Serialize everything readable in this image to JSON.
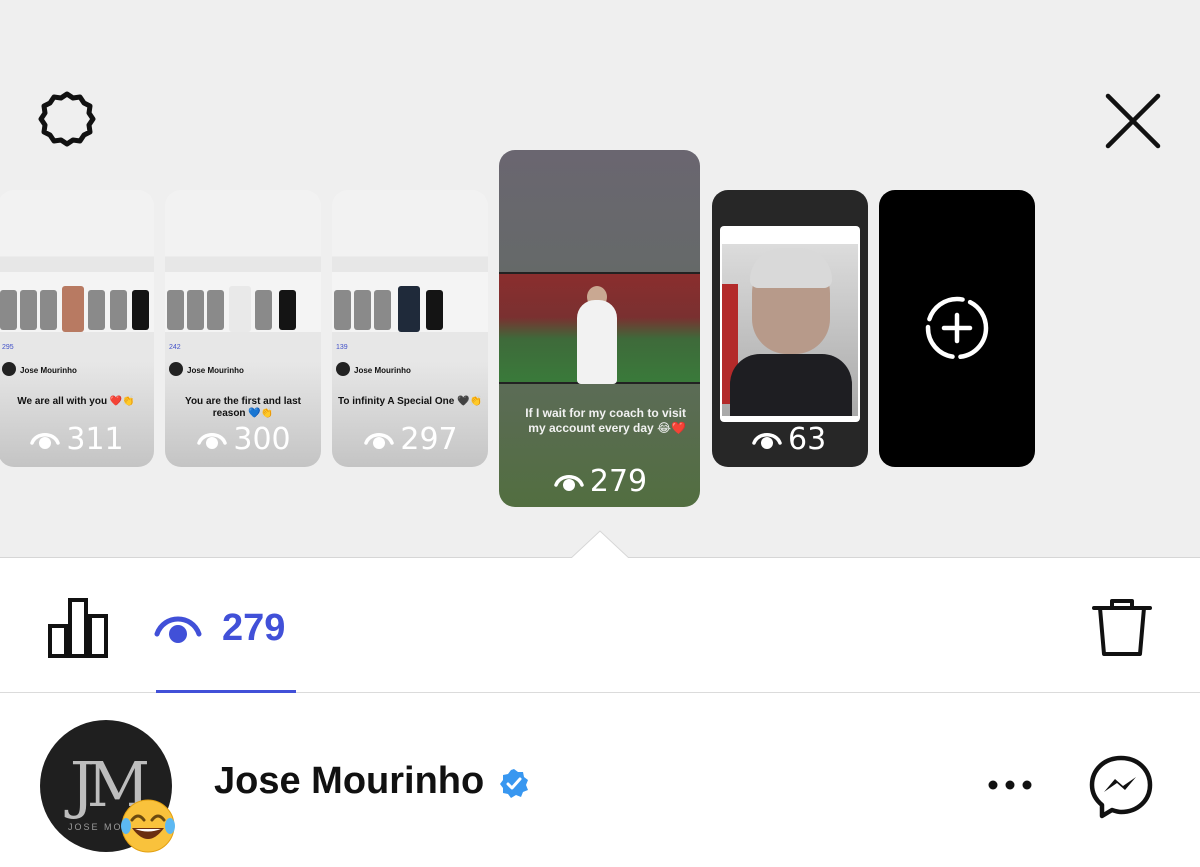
{
  "header": {
    "settings_icon": "gear-icon",
    "close_icon": "close-icon"
  },
  "stories": [
    {
      "views": "311",
      "caption": "We are all with you ❤️👏",
      "mini_count": "295",
      "mini_user": "Jose Mourinho"
    },
    {
      "views": "300",
      "caption": "You are the first and last reason 💙👏",
      "mini_count": "242",
      "mini_user": "Jose Mourinho"
    },
    {
      "views": "297",
      "caption": "To infinity A Special One 🖤👏",
      "mini_count": "139",
      "mini_user": "Jose Mourinho"
    },
    {
      "views": "279",
      "caption": "If I wait for my coach to visit my account every day 😂❤️"
    },
    {
      "views": "63"
    }
  ],
  "add_story_icon": "add-story-icon",
  "toolbar": {
    "insights_icon": "bar-chart-icon",
    "viewers_count": "279",
    "delete_icon": "trash-icon",
    "accent_color": "#4150d8"
  },
  "profile": {
    "name": "Jose Mourinho",
    "avatar_monogram": "JM",
    "avatar_subtext": "JOSE MOURI",
    "emoji": "😂",
    "verified_icon": "verified-badge-icon",
    "more_icon": "more-horizontal-icon",
    "messenger_icon": "messenger-icon"
  }
}
